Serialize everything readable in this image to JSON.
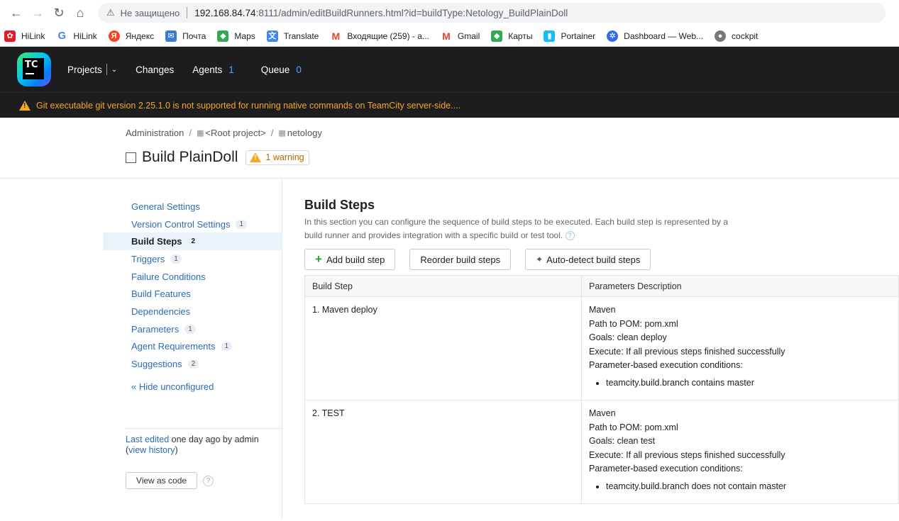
{
  "browser": {
    "insecure_label": "Не защищено",
    "url_host": "192.168.84.74",
    "url_rest": ":8111/admin/editBuildRunners.html?id=buildType:Netology_BuildPlainDoll",
    "bookmarks": [
      {
        "label": "HiLink",
        "icon": "huawei-icon",
        "color": "#e21c2a"
      },
      {
        "label": "HiLink",
        "icon": "google-icon",
        "color": "#4285f4"
      },
      {
        "label": "Яндекс",
        "icon": "yandex-icon",
        "color": "#fc3f1d"
      },
      {
        "label": "Почта",
        "icon": "mail-icon",
        "color": "#3a7bd5"
      },
      {
        "label": "Maps",
        "icon": "maps-icon",
        "color": "#34a853"
      },
      {
        "label": "Translate",
        "icon": "translate-icon",
        "color": "#4285f4"
      },
      {
        "label": "Входящие (259) - a...",
        "icon": "gmail-icon",
        "color": "#ea4335"
      },
      {
        "label": "Gmail",
        "icon": "gmail-icon",
        "color": "#ea4335"
      },
      {
        "label": "Карты",
        "icon": "maps-icon",
        "color": "#34a853"
      },
      {
        "label": "Portainer",
        "icon": "portainer-icon",
        "color": "#13bef9"
      },
      {
        "label": "Dashboard — Web...",
        "icon": "dashboard-icon",
        "color": "#326ce5"
      },
      {
        "label": "cockpit",
        "icon": "cockpit-icon",
        "color": "#555555"
      }
    ]
  },
  "header": {
    "logo_text": "TC",
    "nav": {
      "projects": "Projects",
      "changes": "Changes",
      "agents": "Agents",
      "agents_count": "1",
      "queue": "Queue",
      "queue_count": "0"
    },
    "warning": "Git executable git version 2.25.1.0 is not supported for running native commands on TeamCity server-side...."
  },
  "page": {
    "breadcrumb": [
      "Administration",
      "<Root project>",
      "netology"
    ],
    "title": "Build PlainDoll",
    "warning_badge": "1 warning"
  },
  "sidebar": {
    "items": [
      {
        "label": "General Settings",
        "count": ""
      },
      {
        "label": "Version Control Settings",
        "count": "1"
      },
      {
        "label": "Build Steps",
        "count": "2"
      },
      {
        "label": "Triggers",
        "count": "1"
      },
      {
        "label": "Failure Conditions",
        "count": ""
      },
      {
        "label": "Build Features",
        "count": ""
      },
      {
        "label": "Dependencies",
        "count": ""
      },
      {
        "label": "Parameters",
        "count": "1"
      },
      {
        "label": "Agent Requirements",
        "count": "1"
      },
      {
        "label": "Suggestions",
        "count": "2"
      }
    ],
    "hide_unconfigured": "« Hide unconfigured",
    "footer": {
      "last_edited_link": "Last edited",
      "last_edited_text": " one day ago by admin",
      "open_paren": "(",
      "view_history": "view history",
      "close_paren": ")",
      "view_as_code": "View as code"
    }
  },
  "main": {
    "title": "Build Steps",
    "description": "In this section you can configure the sequence of build steps to be executed. Each build step is represented by a build runner and provides integration with a specific build or test tool.",
    "buttons": {
      "add": "Add build step",
      "reorder": "Reorder build steps",
      "autodetect": "Auto-detect build steps"
    },
    "table": {
      "headers": [
        "Build Step",
        "Parameters Description"
      ],
      "rows": [
        {
          "step": "1. Maven deploy",
          "runner": "Maven",
          "pom": "Path to POM: pom.xml",
          "goals": "Goals: clean deploy",
          "execute": "Execute: If all previous steps finished successfully",
          "conditions_label": "Parameter-based execution conditions:",
          "condition": "teamcity.build.branch contains master"
        },
        {
          "step": "2. TEST",
          "runner": "Maven",
          "pom": "Path to POM: pom.xml",
          "goals": "Goals: clean test",
          "execute": "Execute: If all previous steps finished successfully",
          "conditions_label": "Parameter-based execution conditions:",
          "condition": "teamcity.build.branch does not contain master"
        }
      ]
    }
  }
}
